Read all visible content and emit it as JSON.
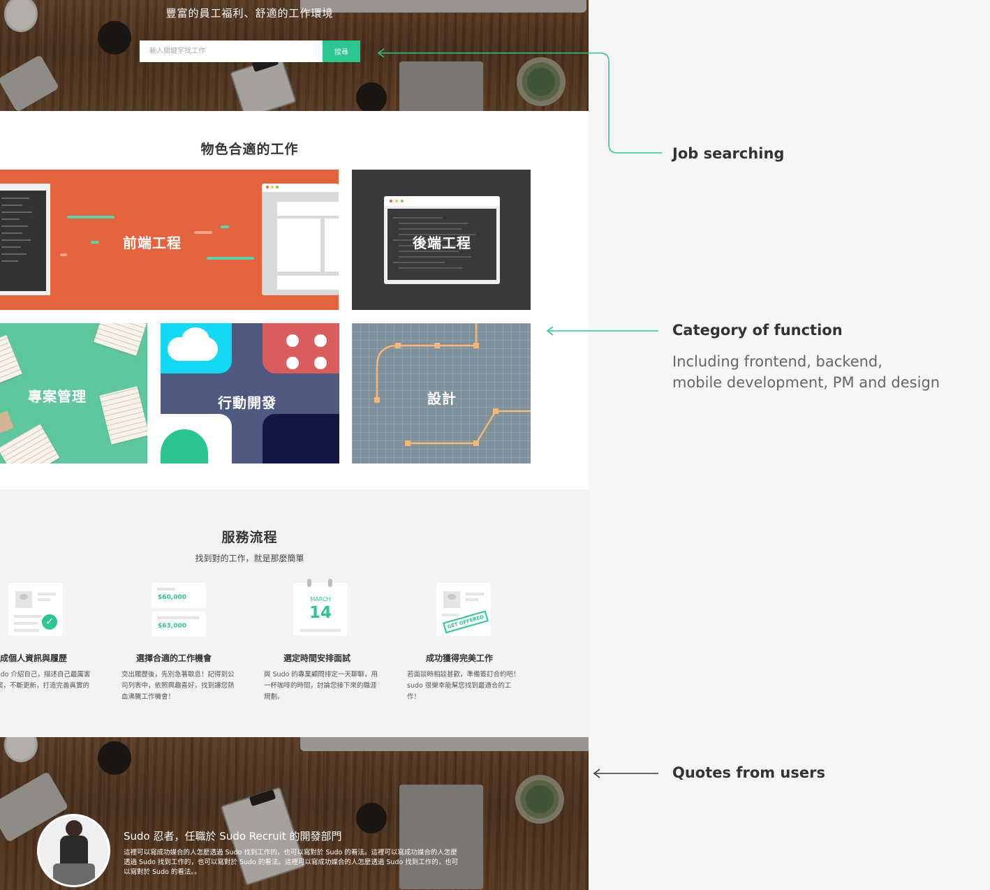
{
  "hero": {
    "headline": "豐富的員工福利、舒適的工作環境",
    "search_placeholder": "輸入關鍵字找工作",
    "search_button": "搜尋"
  },
  "categories": {
    "title": "物色合適的工作",
    "tiles": [
      {
        "label": "前端工程",
        "color": "#e3643c"
      },
      {
        "label": "後端工程",
        "color": "#3a3a3a"
      },
      {
        "label": "專案管理",
        "color": "#5ec79e"
      },
      {
        "label": "行動開發",
        "color": "#4f5a82"
      },
      {
        "label": "設計",
        "color": "#7e919b"
      }
    ]
  },
  "process": {
    "title": "服務流程",
    "subtitle": "找到對的工作，就是那麼簡單",
    "salary_1": "$60,000",
    "salary_2": "$63,000",
    "calendar_month": "MARCH",
    "calendar_day": "14",
    "stamp": "GET OFFERED",
    "steps": [
      {
        "title": "完成個人資訊與履歷",
        "desc": "在 Sudo 介紹自己，描述自己最厲害的專案，不斷更新，打造完善真實的履歷！"
      },
      {
        "title": "選擇合適的工作機會",
        "desc": "交出履歷後，先別急著歇息！記得到公司列表中，依照興趣喜好，找到讓您熱血沸騰工作機會！"
      },
      {
        "title": "選定時間安排面試",
        "desc": "與 Sudo 的專業顧問排定一天聊聊，用一杯咖啡的時間，討論您接下來的職涯規劃。"
      },
      {
        "title": "成功獲得完美工作",
        "desc": "若面談時相談甚歡，準備簽訂合約吧！ sudo 很榮幸能幫您找到最適合的工作！"
      }
    ]
  },
  "quote": {
    "title": "Sudo 忍者，任職於 Sudo Recruit 的開發部門",
    "body": "這裡可以寫成功媒合的人怎麼透過 Sudo 找到工作的，也可以寫對於 Sudo 的看法。這裡可以寫成功媒合的人怎麼透過 Sudo 找到工作的，也可以寫對於 Sudo 的看法。這裡可以寫成功媒合的人怎麼透過 Sudo 找到工作的，也可以寫對於 Sudo 的看法。。"
  },
  "annotations": {
    "search": {
      "title": "Job searching"
    },
    "category": {
      "title": "Category of function",
      "desc_line1": "Including frontend, backend,",
      "desc_line2": "mobile development, PM and design"
    },
    "quotes": {
      "title": "Quotes from users"
    }
  },
  "colors": {
    "accent": "#2dc590",
    "annotation_line_green": "#2dc590",
    "annotation_line_dark": "#333333"
  }
}
